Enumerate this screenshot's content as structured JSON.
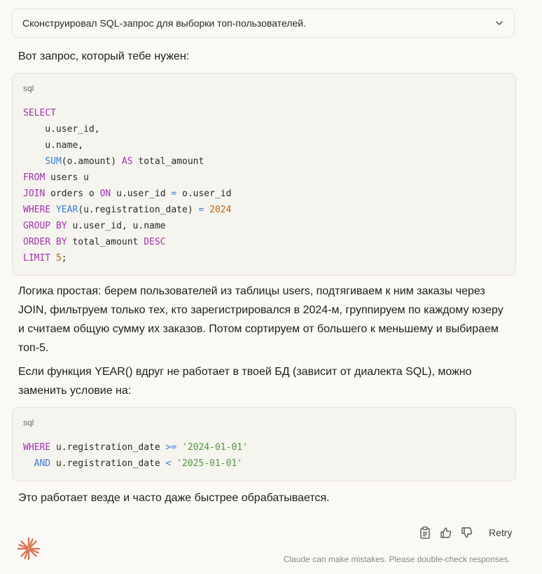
{
  "summary": {
    "text": "Сконструировал SQL-запрос для выборки топ-пользователей."
  },
  "intro": "Вот запрос, который тебе нужен:",
  "code1": {
    "lang": "sql",
    "lines": [
      [
        [
          "kw",
          "SELECT"
        ]
      ],
      [
        [
          "t",
          "    u.user_id,"
        ]
      ],
      [
        [
          "t",
          "    u.name,"
        ]
      ],
      [
        [
          "t",
          "    "
        ],
        [
          "fn",
          "SUM"
        ],
        [
          "t",
          "(o.amount) "
        ],
        [
          "kw",
          "AS"
        ],
        [
          "t",
          " total_amount"
        ]
      ],
      [
        [
          "kw",
          "FROM"
        ],
        [
          "t",
          " users u"
        ]
      ],
      [
        [
          "kw",
          "JOIN"
        ],
        [
          "t",
          " orders o "
        ],
        [
          "kw",
          "ON"
        ],
        [
          "t",
          " u.user_id "
        ],
        [
          "op",
          "="
        ],
        [
          "t",
          " o.user_id"
        ]
      ],
      [
        [
          "kw",
          "WHERE"
        ],
        [
          "t",
          " "
        ],
        [
          "fn",
          "YEAR"
        ],
        [
          "t",
          "(u.registration_date) "
        ],
        [
          "op",
          "="
        ],
        [
          "t",
          " "
        ],
        [
          "num",
          "2024"
        ]
      ],
      [
        [
          "kw",
          "GROUP BY"
        ],
        [
          "t",
          " u.user_id, u.name"
        ]
      ],
      [
        [
          "kw",
          "ORDER BY"
        ],
        [
          "t",
          " total_amount "
        ],
        [
          "kw",
          "DESC"
        ]
      ],
      [
        [
          "kw",
          "LIMIT"
        ],
        [
          "t",
          " "
        ],
        [
          "num",
          "5"
        ],
        [
          "t",
          ";"
        ]
      ]
    ]
  },
  "explanation": "Логика простая: берем пользователей из таблицы users, подтягиваем к ним заказы через JOIN, фильтруем только тех, кто зарегистрировался в 2024-м, группируем по каждому юзеру и считаем общую сумму их заказов. Потом сортируем от большего к меньшему и выбираем топ-5.",
  "alt_note": "Если функция YEAR() вдруг не работает в твоей БД (зависит от диалекта SQL), можно заменить условие на:",
  "code2": {
    "lang": "sql",
    "lines": [
      [
        [
          "kw",
          "WHERE"
        ],
        [
          "t",
          " u.registration_date "
        ],
        [
          "op",
          ">="
        ],
        [
          "t",
          " "
        ],
        [
          "str",
          "'2024-01-01'"
        ]
      ],
      [
        [
          "t",
          "  "
        ],
        [
          "fn",
          "AND"
        ],
        [
          "t",
          " u.registration_date "
        ],
        [
          "op",
          "<"
        ],
        [
          "t",
          " "
        ],
        [
          "str",
          "'2025-01-01'"
        ]
      ]
    ]
  },
  "closing": "Это работает везде и часто даже быстрее обрабатывается.",
  "actions": {
    "copy_icon": "clipboard-icon",
    "like_icon": "thumbs-up-icon",
    "dislike_icon": "thumbs-down-icon",
    "retry_label": "Retry"
  },
  "disclaimer": "Claude can make mistakes. Please double-check responses.",
  "colors": {
    "keyword": "#a431b0",
    "function": "#3a7bd5",
    "number": "#b7680e",
    "string": "#4f9a3b",
    "logo": "#d97757"
  }
}
